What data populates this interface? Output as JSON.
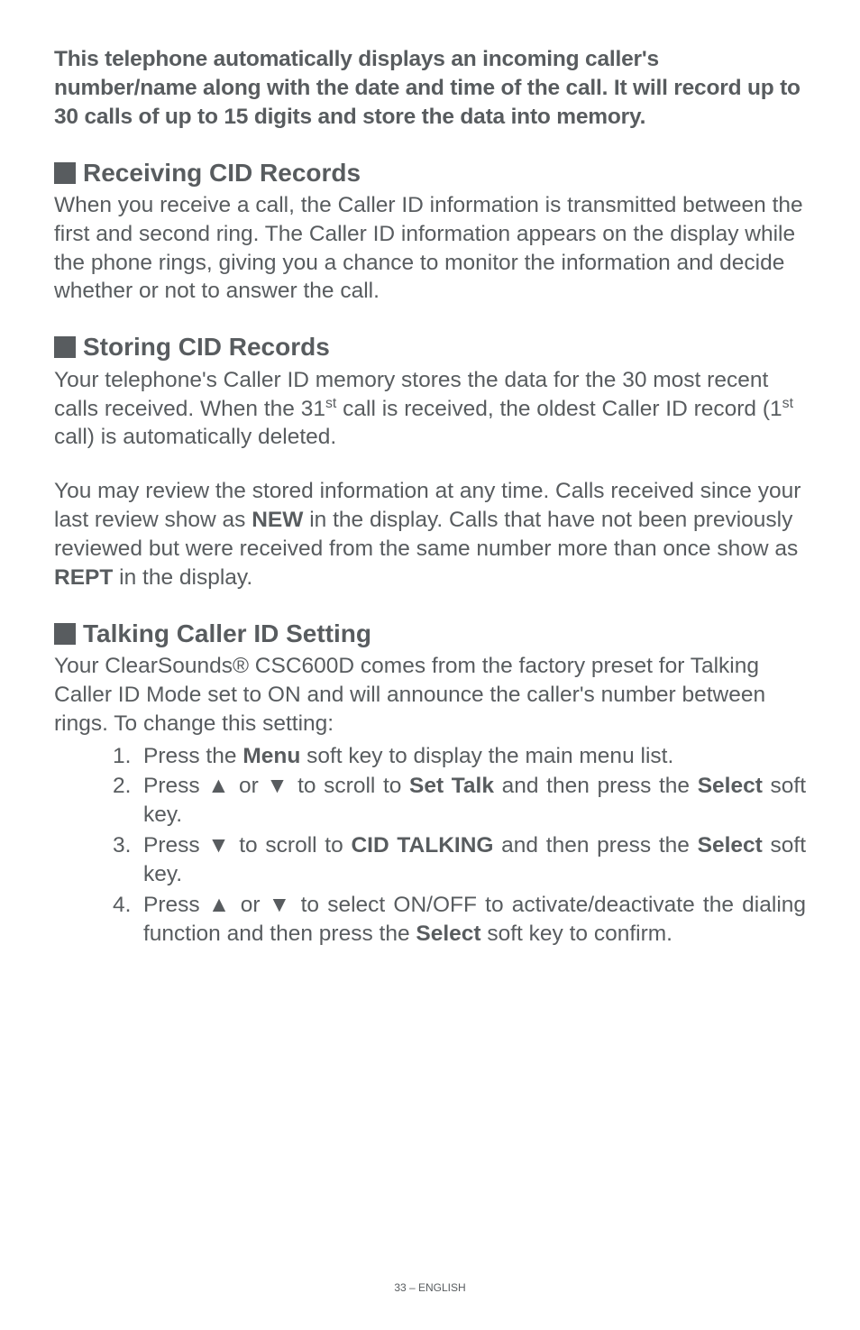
{
  "intro": "This telephone automatically displays an incoming caller's number/name along with the date and time of the call. It will record up to 30 calls of up to 15 digits and store the data into memory.",
  "sections": {
    "receiving": {
      "title": "Receiving CID Records",
      "body": "When you receive a call, the Caller ID information is transmitted between the first and second ring. The Caller ID information appears on the display while the phone rings, giving you a chance to monitor the information and decide whether or not to answer the call."
    },
    "storing": {
      "title": "Storing CID Records",
      "p1_a": "Your telephone's Caller ID memory stores the data for the 30 most recent calls received.  When the 31",
      "p1_b": " call is received, the oldest Caller ID record (1",
      "p1_c": " call) is automatically deleted.",
      "sup": "st",
      "p2_a": "You may review the stored information at any time. Calls received since your last review show as ",
      "p2_new": "NEW",
      "p2_b": " in the display. Calls that have not been previously reviewed but were received from the same number more than once show as ",
      "p2_rept": "REPT",
      "p2_c": " in the display."
    },
    "talking": {
      "title": "Talking Caller ID Setting",
      "body": "Your ClearSounds® CSC600D comes from the factory preset for Talking Caller ID Mode set to ON and will announce the caller's number between rings. To change this setting:",
      "items": {
        "n1": "1.",
        "t1a": "Press the ",
        "t1menu": "Menu",
        "t1b": " soft key to display the main menu list.",
        "n2": "2.",
        "t2a": "Press ",
        "up": "▲",
        "down": "▼",
        "or": "  or ",
        "t2b": "  to scroll to ",
        "t2settalk": "Set Talk",
        "t2c": " and then press the ",
        "select": "Select",
        "t2d": " soft key.",
        "n3": "3.",
        "t3a": "Press ",
        "t3b": "  to scroll to ",
        "t3cid": "CID TALKING",
        "t3c": " and then press the ",
        "t3d": " soft key.",
        "n4": "4.",
        "t4a": "Press ",
        "t4b": "  to select ON/OFF to activate/deactivate the dialing function and then press the ",
        "t4c": " soft key to confirm."
      }
    }
  },
  "footer": "33 – ENGLISH"
}
